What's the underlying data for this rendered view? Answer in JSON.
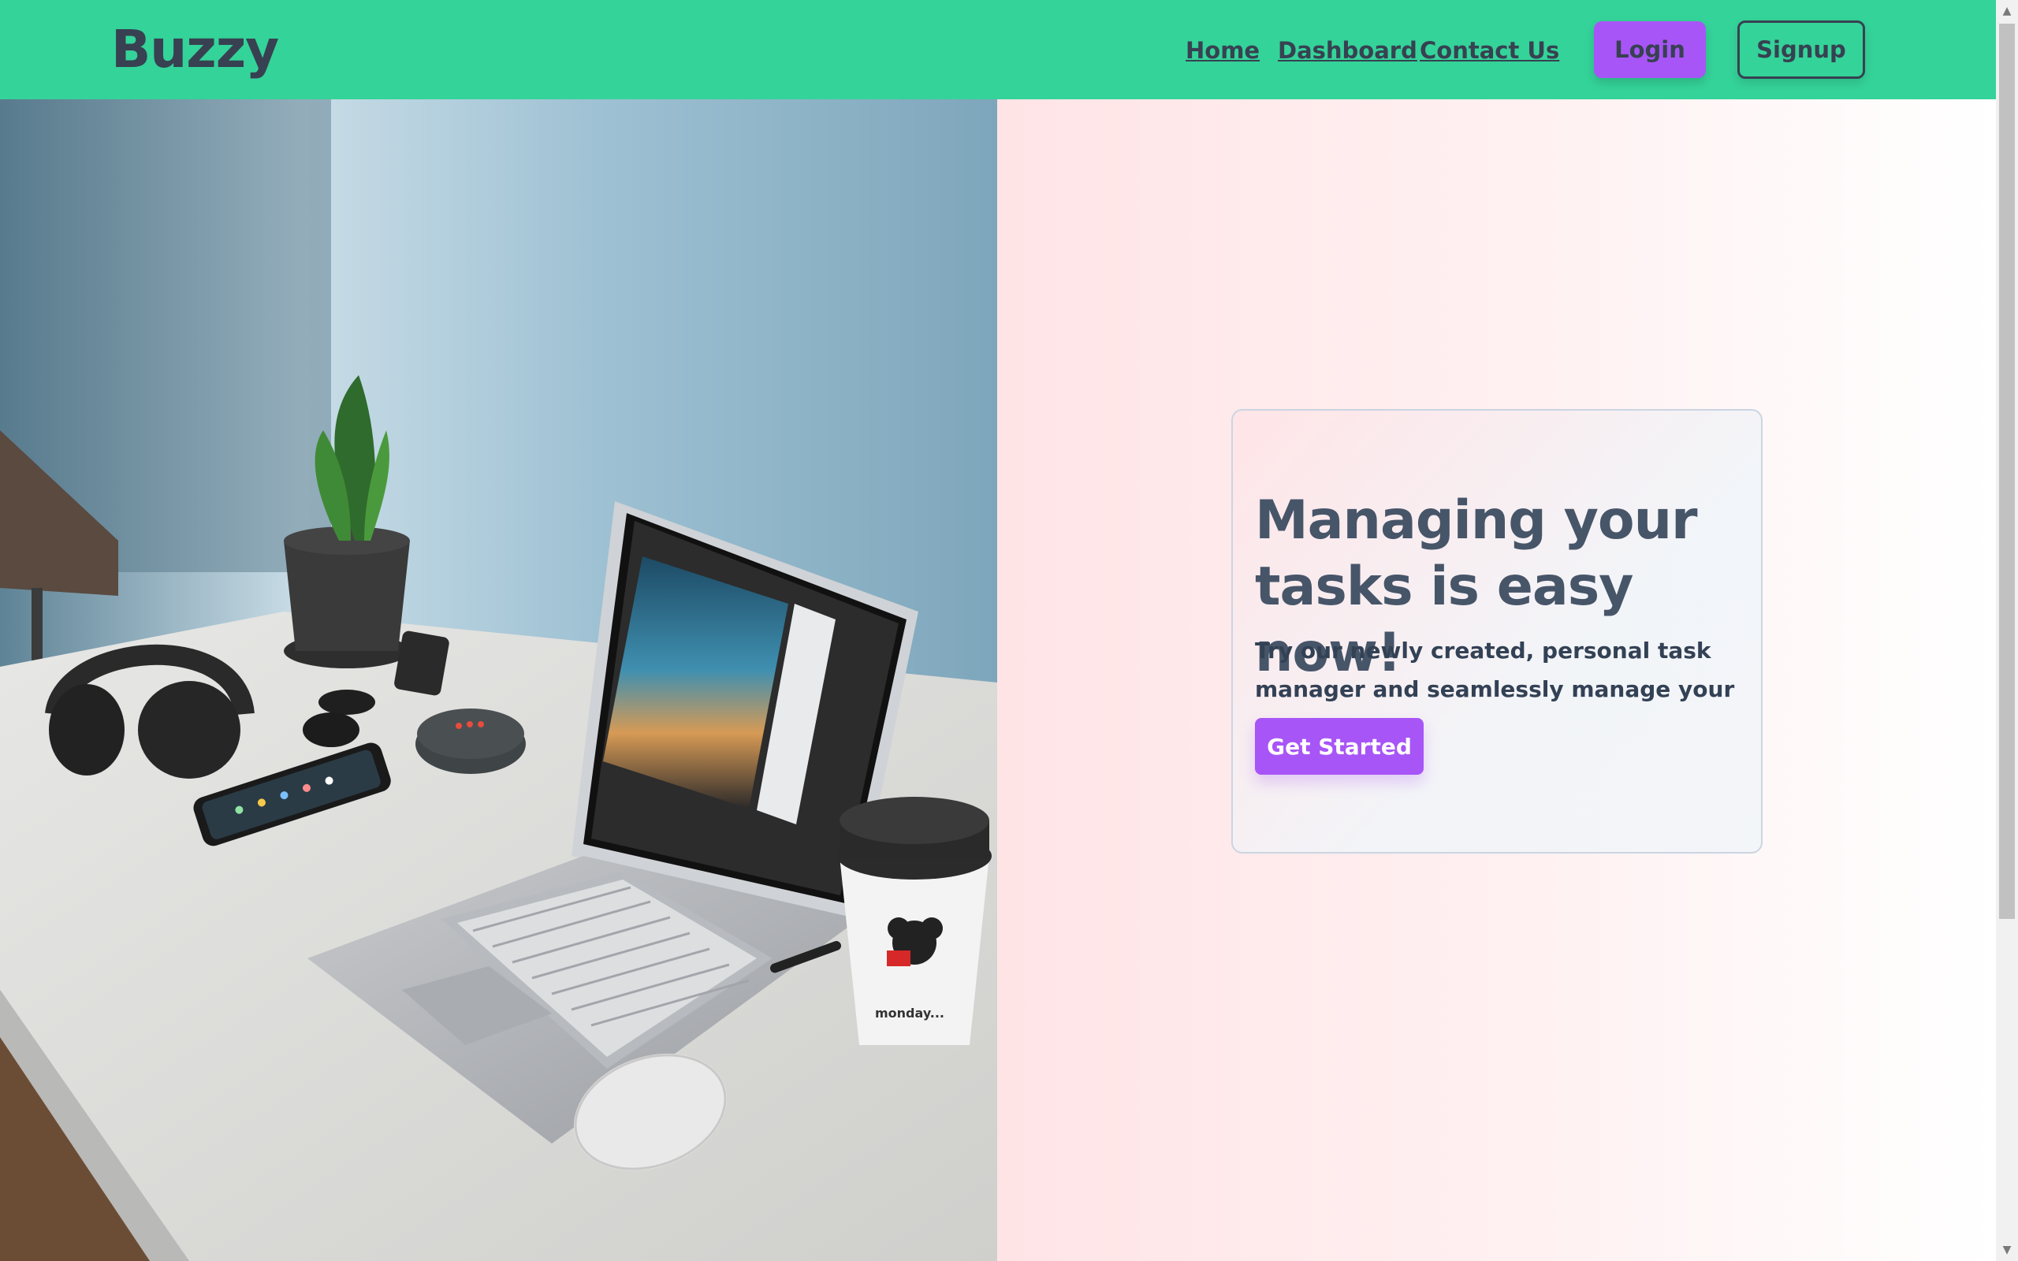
{
  "navbar": {
    "brand": "Buzzy",
    "links": [
      "Home",
      "Dashboard",
      "Contact Us"
    ],
    "login_label": "Login",
    "signup_label": "Signup",
    "background_color": "#34d399",
    "primary_button_color": "#a855f7"
  },
  "hero": {
    "image_alt": "Desk workspace with laptop, plant, headphones, phone, smart speaker, coffee cup and mouse",
    "title": "Managing your tasks is easy now!",
    "description": "Try our newly created, personal task manager and seamlessly manage your tasks.",
    "cta_label": "Get Started",
    "cup_text": "monday..."
  },
  "scrollbar": {
    "up_icon": "▲",
    "down_icon": "▼"
  }
}
